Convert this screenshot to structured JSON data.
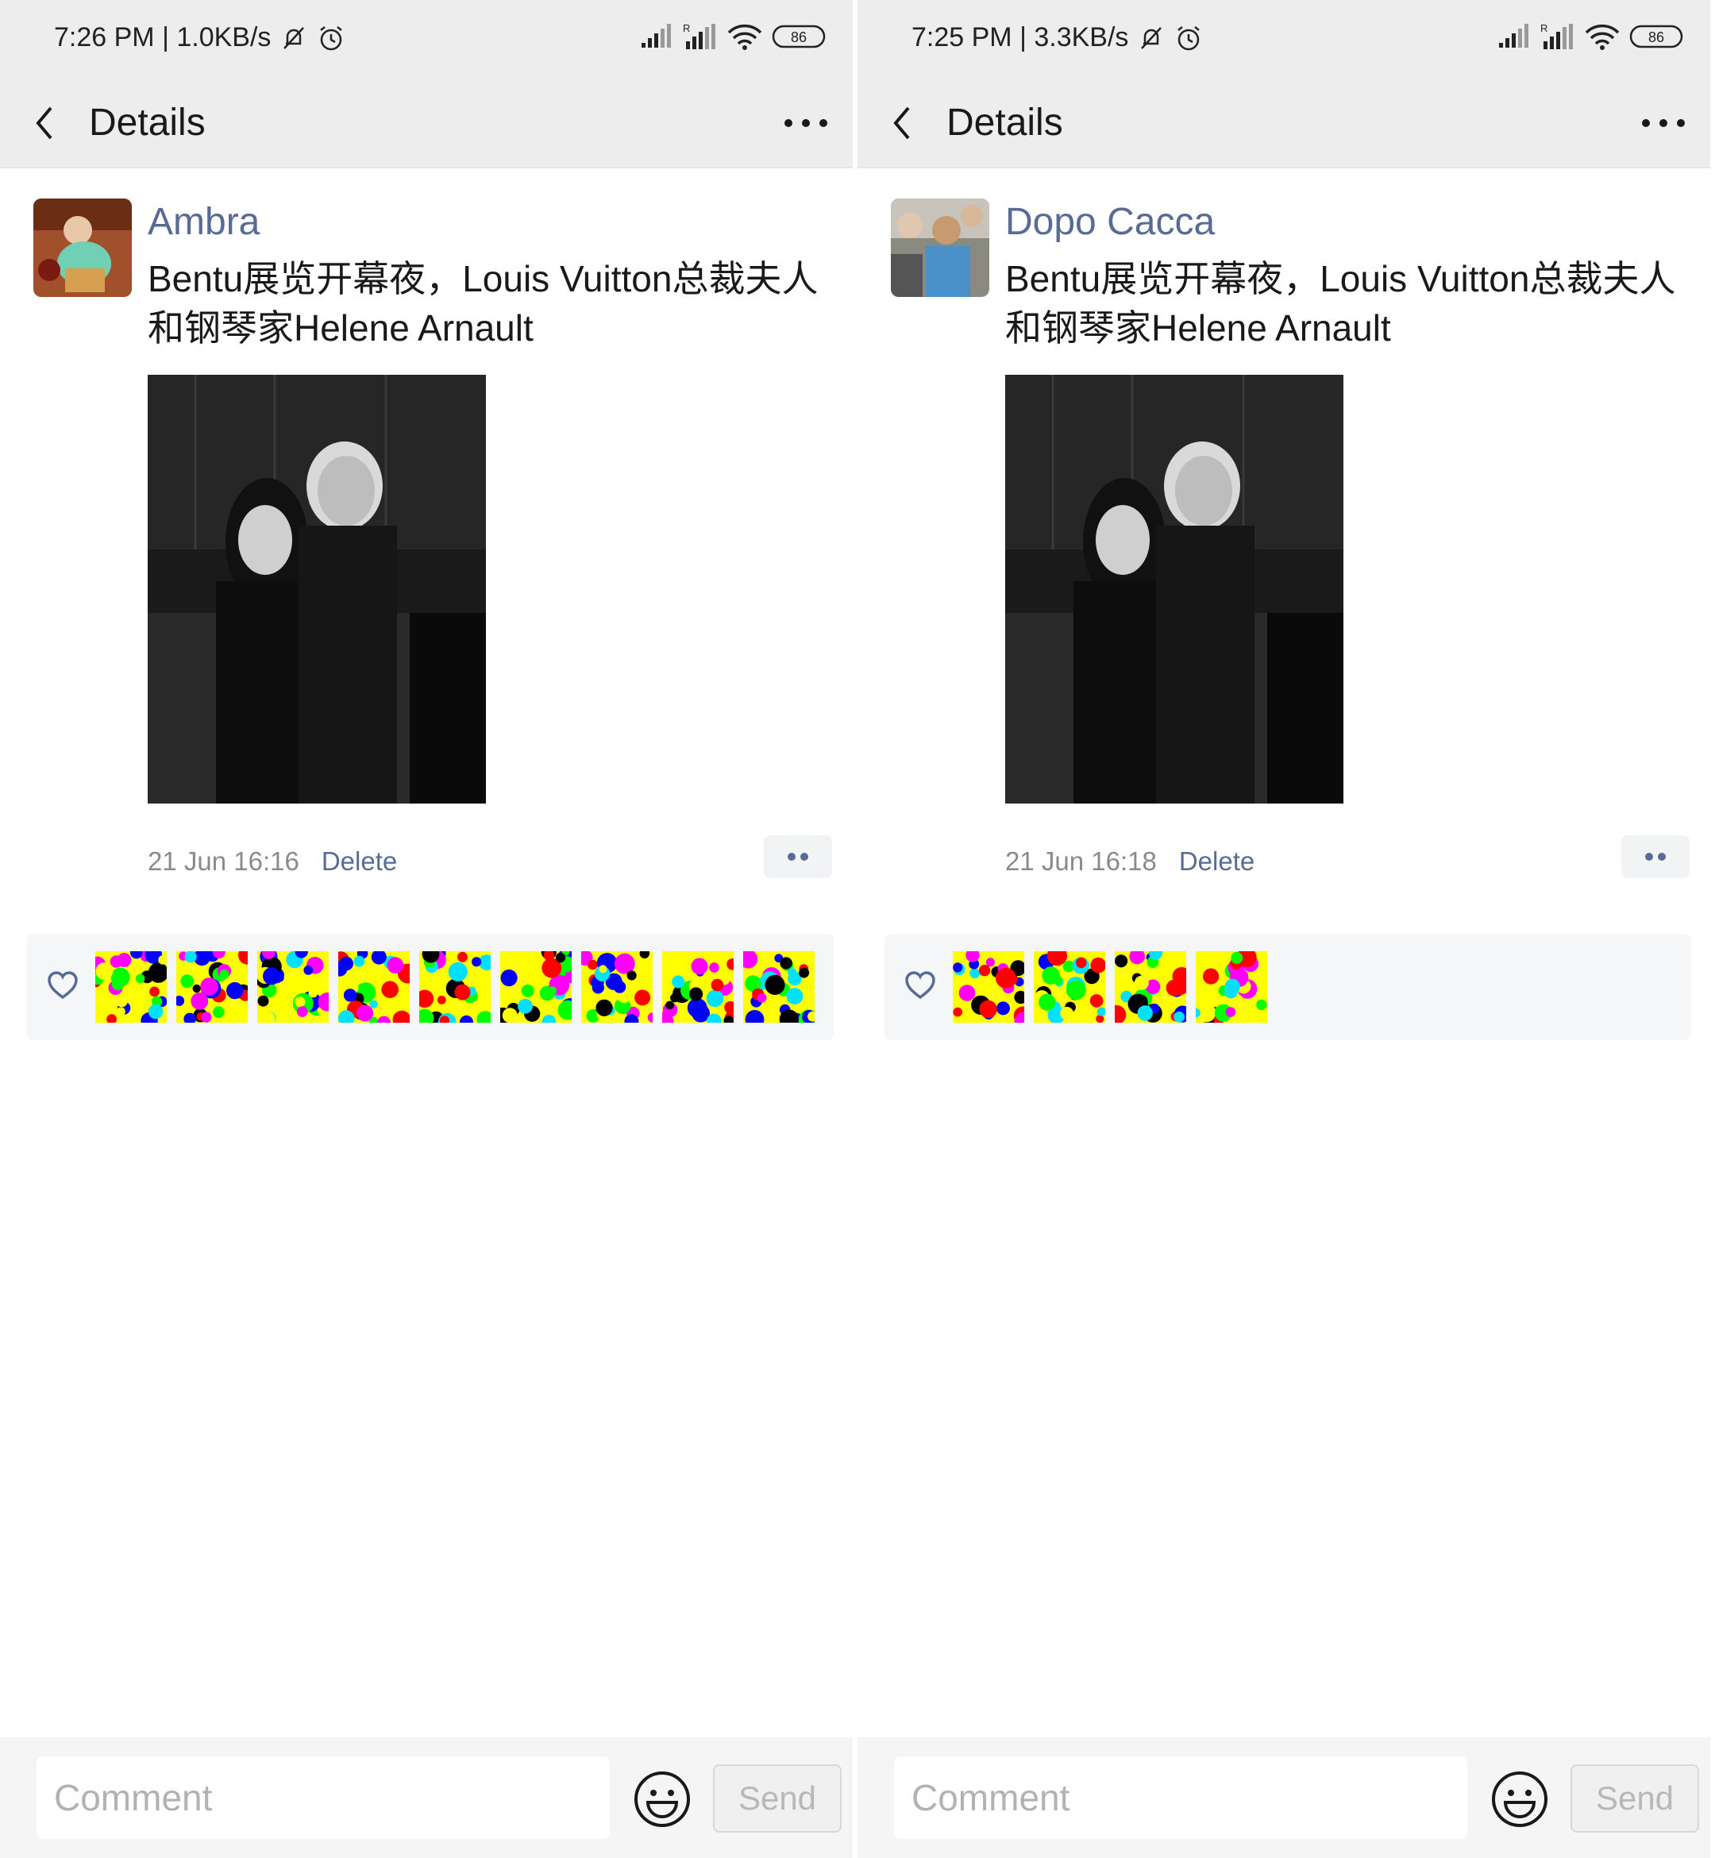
{
  "left": {
    "status": {
      "time": "7:26 PM | 1.0KB/s",
      "battery": "86"
    },
    "nav": {
      "title": "Details"
    },
    "post": {
      "username": "Ambra",
      "text": "Bentu展览开幕夜，Louis Vuitton总裁夫人和钢琴家Helene Arnault",
      "time": "21 Jun 16:16",
      "delete_label": "Delete"
    },
    "likes_count": 9,
    "comment": {
      "placeholder": "Comment",
      "send_label": "Send"
    }
  },
  "right": {
    "status": {
      "time": "7:25 PM | 3.3KB/s",
      "battery": "86"
    },
    "nav": {
      "title": "Details"
    },
    "post": {
      "username": "Dopo Cacca",
      "text": "Bentu展览开幕夜，Louis Vuitton总裁夫人和钢琴家Helene Arnault",
      "time": "21 Jun 16:18",
      "delete_label": "Delete"
    },
    "likes_count": 4,
    "comment": {
      "placeholder": "Comment",
      "send_label": "Send"
    }
  },
  "colors": {
    "link": "#576b95",
    "header_bg": "#ededed",
    "likes_bg": "#f5f6f7",
    "text": "#191919"
  },
  "icons": [
    "back-chevron-icon",
    "more-icon",
    "heart-icon",
    "emoji-icon",
    "mute-bell-icon",
    "alarm-icon",
    "signal-icon",
    "wifi-icon",
    "battery-icon"
  ]
}
